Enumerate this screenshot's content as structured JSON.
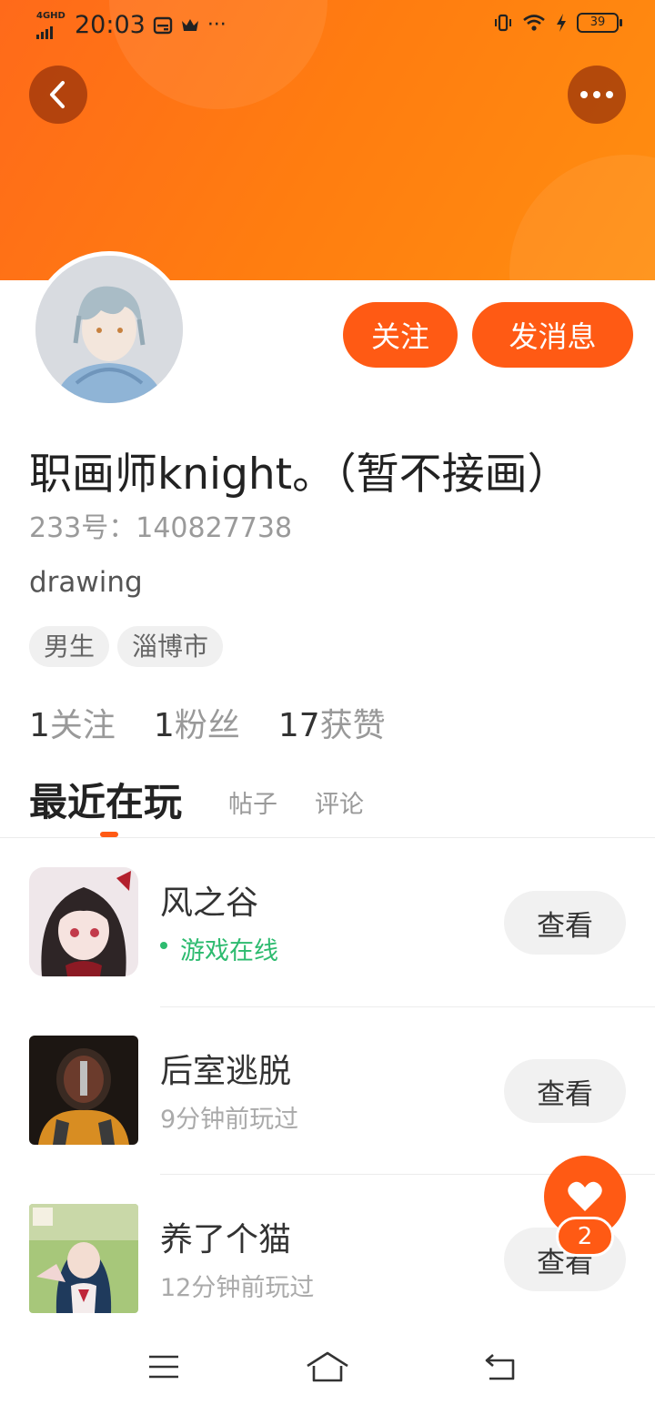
{
  "status_bar": {
    "network": "4GHD",
    "time": "20:03",
    "overflow": "···",
    "battery": "39"
  },
  "header": {
    "back_icon": "chevron-left-icon",
    "more_icon": "more-horizontal-icon"
  },
  "profile": {
    "follow_label": "关注",
    "message_label": "发消息",
    "name": "职画师knight。（暂不接画）",
    "id_text": "233号：140827738",
    "bio": "drawing",
    "tags": [
      "男生",
      "淄博市"
    ],
    "stats": [
      {
        "num": "1",
        "label": "关注"
      },
      {
        "num": "1",
        "label": "粉丝"
      },
      {
        "num": "17",
        "label": "获赞"
      }
    ]
  },
  "tabs": {
    "active": "最近在玩",
    "posts": "帖子",
    "comments": "评论"
  },
  "games": [
    {
      "name": "风之谷",
      "status": "游戏在线",
      "online": true,
      "button": "查看"
    },
    {
      "name": "后室逃脱",
      "status": "9分钟前玩过",
      "online": false,
      "button": "查看"
    },
    {
      "name": "养了个猫",
      "status": "12分钟前玩过",
      "online": false,
      "button": "查看"
    }
  ],
  "like_fab": {
    "icon": "heart-icon",
    "count": "2"
  },
  "colors": {
    "accent": "#ff5a14",
    "online": "#2dbb6f"
  }
}
